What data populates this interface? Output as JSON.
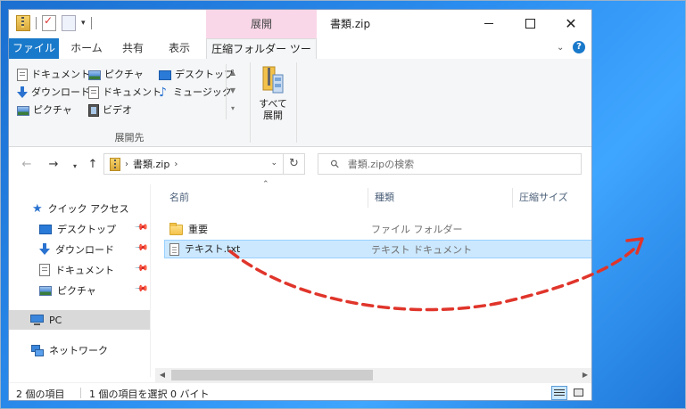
{
  "window": {
    "title": "書類.zip",
    "context_tab_group": "展開",
    "minimize_icon": "minimize-icon",
    "maximize_icon": "maximize-icon",
    "close_glyph": "✕"
  },
  "ribbon_tabs": {
    "file": "ファイル",
    "home": "ホーム",
    "share": "共有",
    "view": "表示",
    "compressed_tools": "圧縮フォルダー ツール"
  },
  "ribbon": {
    "destinations": [
      {
        "label": "ドキュメント",
        "icon": "document-icon"
      },
      {
        "label": "ピクチャ",
        "icon": "picture-icon"
      },
      {
        "label": "デスクトップ",
        "icon": "desktop-icon"
      },
      {
        "label": "ダウンロード",
        "icon": "download-icon"
      },
      {
        "label": "ドキュメント",
        "icon": "document-icon"
      },
      {
        "label": "ミュージック",
        "icon": "music-icon"
      },
      {
        "label": "ピクチャ",
        "icon": "picture-icon"
      },
      {
        "label": "ビデオ",
        "icon": "video-icon"
      }
    ],
    "group_label": "展開先",
    "extract_all_line1": "すべて",
    "extract_all_line2": "展開"
  },
  "address": {
    "path": "書類.zip",
    "search_placeholder": "書類.zipの検索"
  },
  "nav_pane": {
    "quick_access": "クイック アクセス",
    "items": [
      {
        "label": "デスクトップ",
        "icon": "desktop-icon"
      },
      {
        "label": "ダウンロード",
        "icon": "download-icon"
      },
      {
        "label": "ドキュメント",
        "icon": "document-icon"
      },
      {
        "label": "ピクチャ",
        "icon": "picture-icon"
      }
    ],
    "pc": "PC",
    "network": "ネットワーク"
  },
  "columns": {
    "name": "名前",
    "type": "種類",
    "compressed_size": "圧縮サイズ"
  },
  "files": [
    {
      "name": "重要",
      "type": "ファイル フォルダー",
      "icon": "folder-icon",
      "selected": false
    },
    {
      "name": "テキスト.txt",
      "type": "テキスト ドキュメント",
      "icon": "text-file-icon",
      "selected": true
    }
  ],
  "status": {
    "item_count": "2 個の項目",
    "selected_info": "1 個の項目を選択  0 バイト"
  },
  "colors": {
    "file_tab": "#1979ca",
    "context_tab": "#f9d7e8",
    "selection": "#cce8ff",
    "arrow": "#e0352b",
    "desktop": "#2b8ef0"
  }
}
